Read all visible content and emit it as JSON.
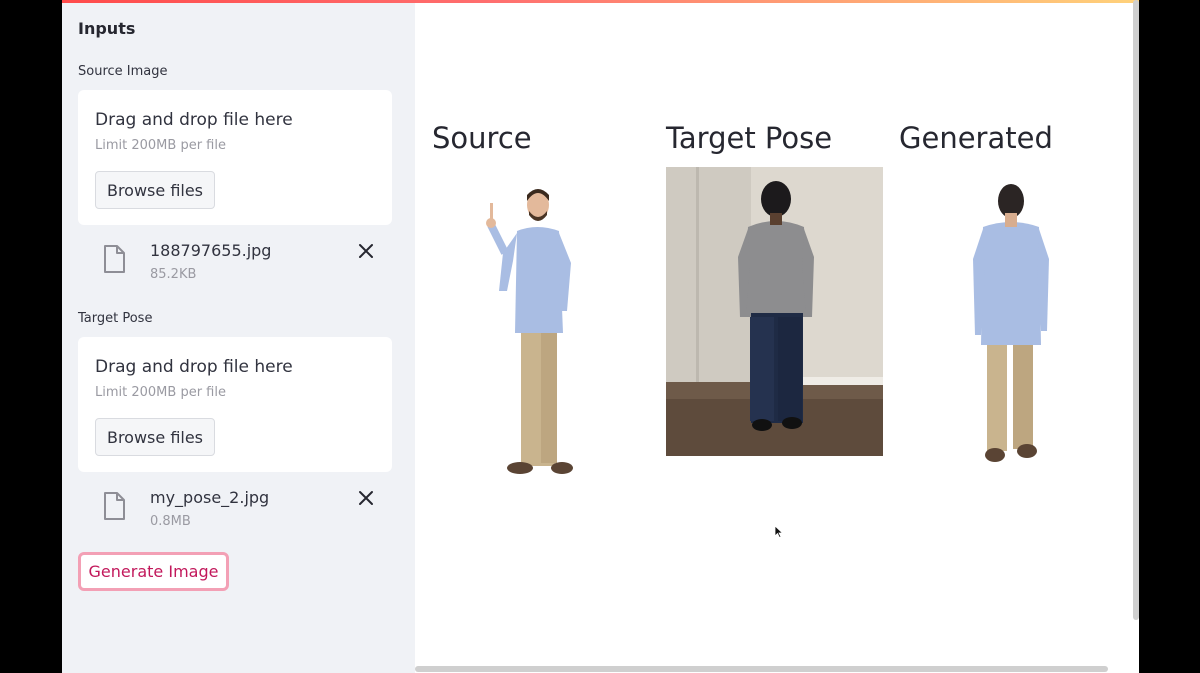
{
  "sidebar": {
    "title": "Inputs",
    "source": {
      "label": "Source Image",
      "drop_text": "Drag and drop file here",
      "limit_text": "Limit 200MB per file",
      "browse_label": "Browse files",
      "file_name": "188797655.jpg",
      "file_size": "85.2KB"
    },
    "target": {
      "label": "Target Pose",
      "drop_text": "Drag and drop file here",
      "limit_text": "Limit 200MB per file",
      "browse_label": "Browse files",
      "file_name": "my_pose_2.jpg",
      "file_size": "0.8MB"
    },
    "generate_label": "Generate Image"
  },
  "main": {
    "columns": [
      {
        "title": "Source"
      },
      {
        "title": "Target Pose"
      },
      {
        "title": "Generated"
      }
    ]
  },
  "colors": {
    "accent": "#c2185b",
    "sidebar_bg": "#f0f2f6",
    "shirt": "#a9bde3",
    "pants": "#c9b48e"
  }
}
